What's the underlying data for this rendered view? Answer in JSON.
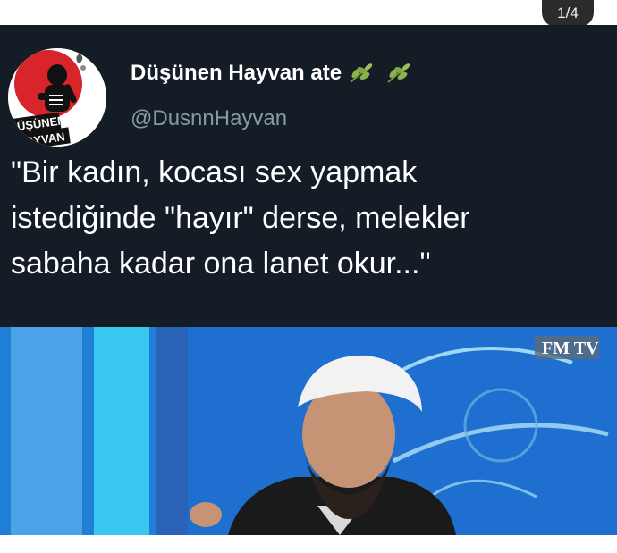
{
  "viewer": {
    "page_counter": "1/4"
  },
  "tweet": {
    "author_name": "Düşünen Hayvan ate",
    "author_handle": "@DusnnHayvan",
    "name_emojis": [
      "herb-icon",
      "herb-icon"
    ],
    "avatar_text_line1": "DÜŞÜNEN",
    "avatar_text_line2": "HAYVAN",
    "text": "\"Bir kadın, kocası sex yapmak\nistediğinde \"hayır\" derse, melekler\nsabaha kadar ona lanet okur...\"",
    "media_watermark": "FM TV"
  },
  "colors": {
    "tweet_background": "#141d26",
    "handle": "#8899a6",
    "studio_blue": "#1f7fd6",
    "studio_cyan": "#39c6ef",
    "avatar_red": "#d8242b"
  }
}
